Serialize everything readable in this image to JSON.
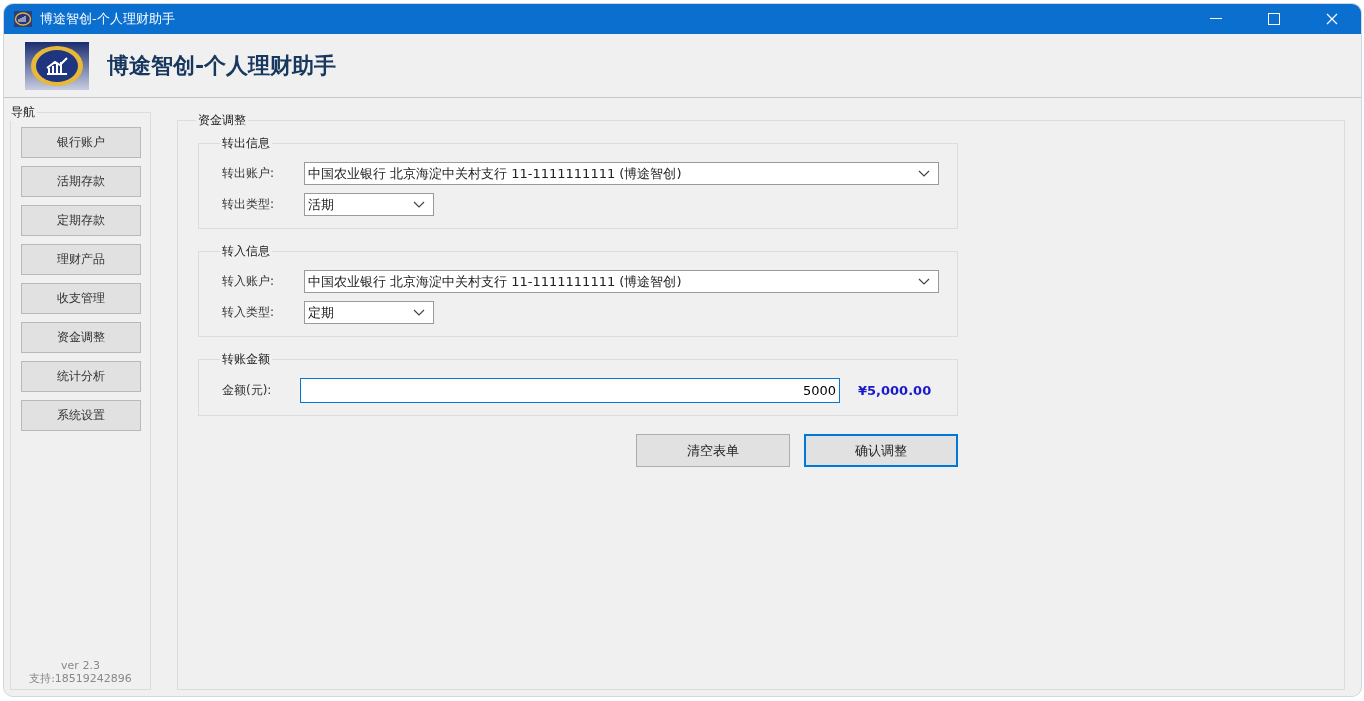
{
  "window": {
    "title": "博途智创-个人理财助手"
  },
  "header": {
    "title": "博途智创-个人理财助手"
  },
  "nav": {
    "title": "导航",
    "items": [
      {
        "label": "银行账户"
      },
      {
        "label": "活期存款"
      },
      {
        "label": "定期存款"
      },
      {
        "label": "理财产品"
      },
      {
        "label": "收支管理"
      },
      {
        "label": "资金调整"
      },
      {
        "label": "统计分析"
      },
      {
        "label": "系统设置"
      }
    ],
    "version": "ver 2.3",
    "support": "支持:18519242896"
  },
  "panel": {
    "title": "资金调整",
    "groups": [
      {
        "title": "转出信息",
        "rows": [
          {
            "kind": "wide",
            "label": "转出账户:",
            "value": "中国农业银行 北京海淀中关村支行 11-1111111111 (博途智创)"
          },
          {
            "kind": "narrow",
            "label": "转出类型:",
            "value": "活期"
          }
        ]
      },
      {
        "title": "转入信息",
        "rows": [
          {
            "kind": "wide",
            "label": "转入账户:",
            "value": "中国农业银行 北京海淀中关村支行 11-1111111111 (博途智创)"
          },
          {
            "kind": "narrow",
            "label": "转入类型:",
            "value": "定期"
          }
        ]
      },
      {
        "title": "转账金额",
        "rows": [
          {
            "kind": "amount",
            "label": "金额(元):",
            "value": "5000",
            "focused": true,
            "formatted": "¥5,000.00"
          }
        ]
      }
    ],
    "buttons": [
      {
        "label": "清空表单",
        "default": false
      },
      {
        "label": "确认调整",
        "default": true
      }
    ]
  }
}
